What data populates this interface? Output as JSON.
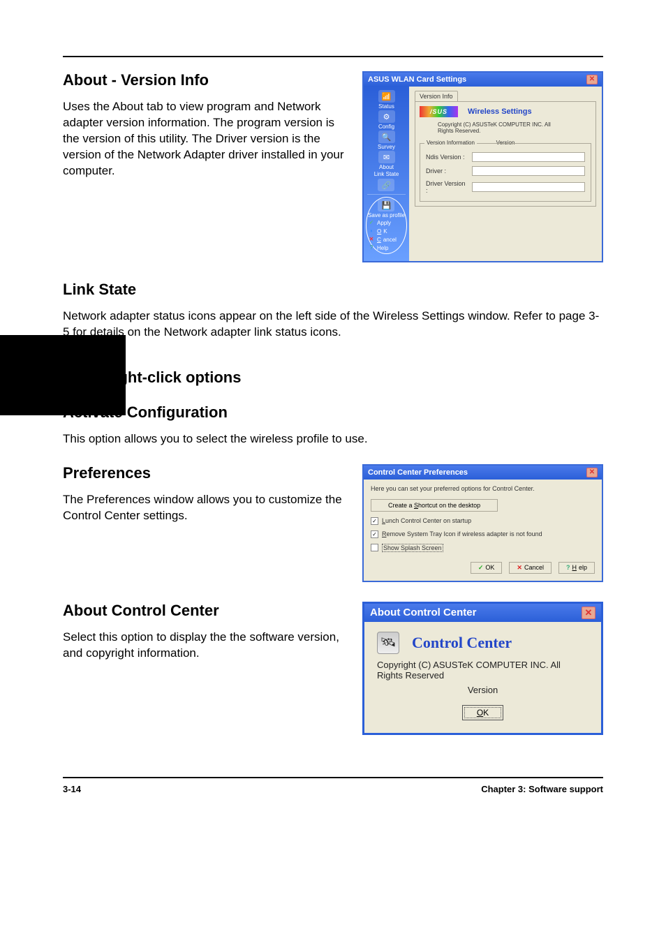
{
  "page": {
    "header_rule": true,
    "about_heading": "About - Version Info",
    "about_text": "Uses the About tab to view program and Network adapter version information. The program version is the version of this utility. The Driver version is the version of the Network Adapter driver installed in your computer.",
    "link_state_heading": "Link State",
    "link_state_text": "Network adapter status icons appear on the left side of the Wireless Settings window. Refer to page 3-5 for details on the Network adapter link status icons.",
    "other_options_heading": "Other right-click options",
    "activate_heading": "Activate Configuration",
    "activate_text": "This option allows you to select the wireless profile to use.",
    "preferences_heading": "Preferences",
    "preferences_text": "The Preferences window allows you to customize the Control Center settings.",
    "about_cc_heading": "About Control Center",
    "about_cc_text": "Select this option to display the the software version, and copyright information.",
    "footer_left": "3-14",
    "footer_right": "Chapter 3: Software support"
  },
  "win1": {
    "title": "ASUS WLAN Card Settings",
    "sidebar": {
      "items": [
        "Status",
        "Config",
        "Survey",
        "About"
      ],
      "link_state": "Link State",
      "save_profile": "Save as profile",
      "apply": "Apply",
      "ok": "OK",
      "cancel": "Cancel",
      "help": "Help"
    },
    "tab": "Version Info",
    "wireless_settings": "Wireless Settings",
    "asus_logo": "/SUS",
    "copyright": "Copyright (C) ASUSTeK COMPUTER INC. All Rights Reserved.",
    "fieldset": {
      "legend": "Version Information",
      "ndis": "Ndis Version :",
      "driver": "Driver :",
      "driver_ver": "Driver Version :"
    },
    "version_label": "Version"
  },
  "win2": {
    "title": "Control Center Preferences",
    "intro": "Here you can set your preferred options for Control Center.",
    "shortcut_btn": "Create a Shortcut on the desktop",
    "opt_launch": "Lunch Control Center on startup",
    "opt_remove": "Remove System Tray Icon if wireless adapter is not found",
    "opt_splash": "Show Splash Screen",
    "btn_ok": "OK",
    "btn_cancel": "Cancel",
    "btn_help": "Help"
  },
  "win3": {
    "title": "About Control Center",
    "cc_title": "Control Center",
    "copyright": "Copyright (C) ASUSTeK COMPUTER INC. All Rights Reserved",
    "version": "Version",
    "ok": "OK"
  }
}
